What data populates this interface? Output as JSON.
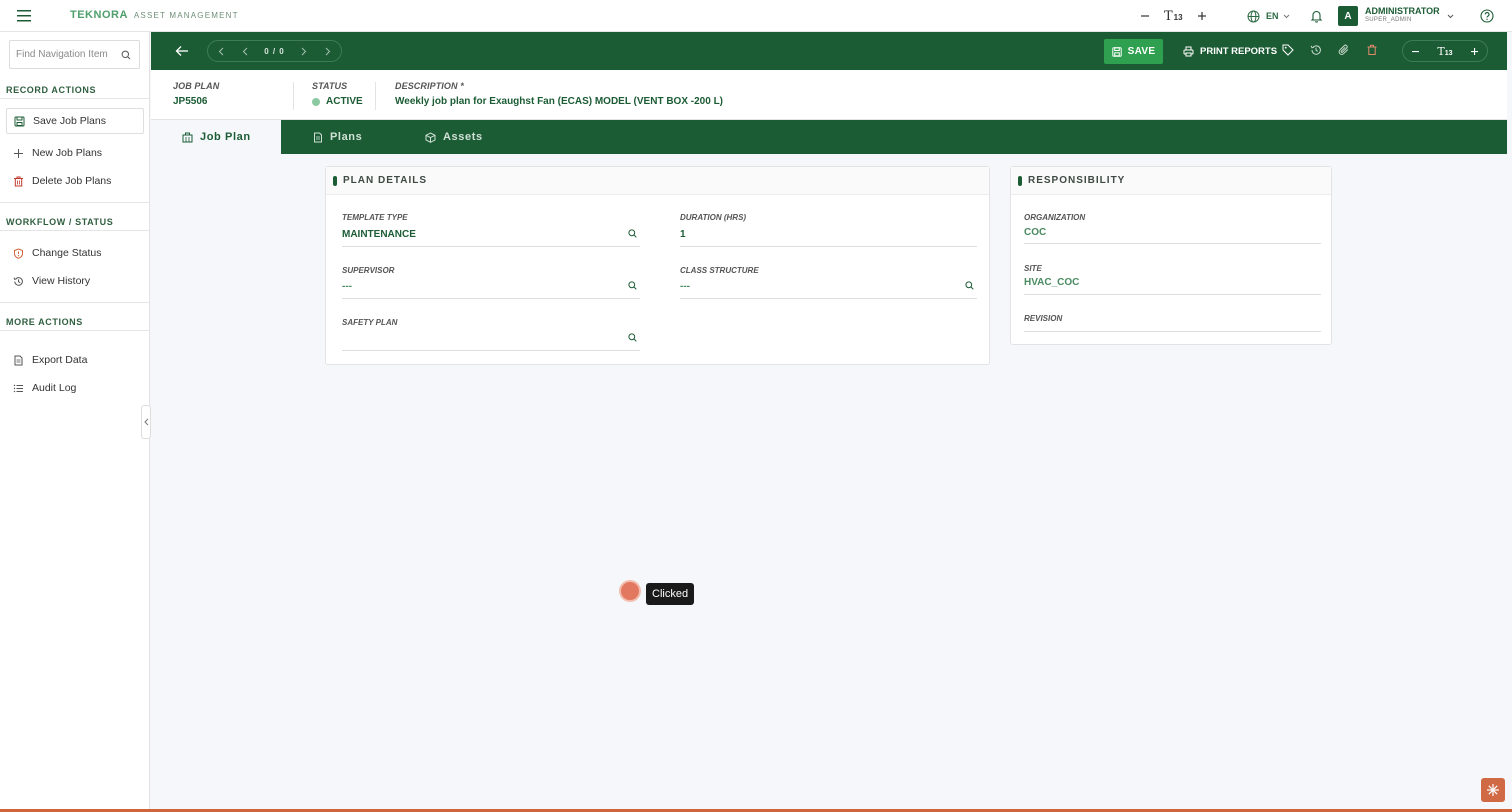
{
  "header": {
    "brand_name": "TEKNORA",
    "brand_sub": "ASSET MANAGEMENT",
    "font_size": "13",
    "language": "EN",
    "user_name": "ADMINISTRATOR",
    "user_role": "SUPER_ADMIN",
    "avatar_initial": "A"
  },
  "sidebar": {
    "search_placeholder": "Find Navigation Item",
    "sections": [
      {
        "title": "RECORD ACTIONS",
        "items": [
          {
            "label": "Save Job Plans",
            "icon": "save-icon"
          },
          {
            "label": "New Job Plans",
            "icon": "plus-icon"
          },
          {
            "label": "Delete Job Plans",
            "icon": "trash-icon"
          }
        ]
      },
      {
        "title": "WORKFLOW / STATUS",
        "items": [
          {
            "label": "Change Status",
            "icon": "shield-icon"
          },
          {
            "label": "View History",
            "icon": "history-icon"
          }
        ]
      },
      {
        "title": "MORE ACTIONS",
        "items": [
          {
            "label": "Export Data",
            "icon": "document-icon"
          },
          {
            "label": "Audit Log",
            "icon": "list-icon"
          }
        ]
      }
    ]
  },
  "toolbar": {
    "pager_count": "0 / 0",
    "save_label": "SAVE",
    "print_label": "PRINT REPORTS",
    "font_size": "13"
  },
  "record": {
    "job_plan_label": "JOB PLAN",
    "job_plan_value": "JP5506",
    "status_label": "STATUS",
    "status_value": "ACTIVE",
    "description_label": "DESCRIPTION *",
    "description_value": "Weekly job plan for Exaughst Fan (ECAS) MODEL (VENT BOX -200 L)"
  },
  "tabs": [
    {
      "label": "Job Plan",
      "icon": "building-icon"
    },
    {
      "label": "Plans",
      "icon": "document-icon"
    },
    {
      "label": "Assets",
      "icon": "cube-icon"
    }
  ],
  "plan_details": {
    "title": "PLAN DETAILS",
    "template_type_label": "TEMPLATE TYPE",
    "template_type_value": "MAINTENANCE",
    "duration_label": "DURATION (HRS)",
    "duration_value": "1",
    "supervisor_label": "SUPERVISOR",
    "supervisor_value": "---",
    "class_structure_label": "CLASS STRUCTURE",
    "class_structure_value": "---",
    "safety_plan_label": "SAFETY PLAN",
    "safety_plan_value": ""
  },
  "responsibility": {
    "title": "RESPONSIBILITY",
    "organization_label": "ORGANIZATION",
    "organization_value": "COC",
    "site_label": "SITE",
    "site_value": "HVAC_COC",
    "revision_label": "REVISION",
    "revision_value": ""
  },
  "click_indicator": {
    "label": "Clicked"
  }
}
